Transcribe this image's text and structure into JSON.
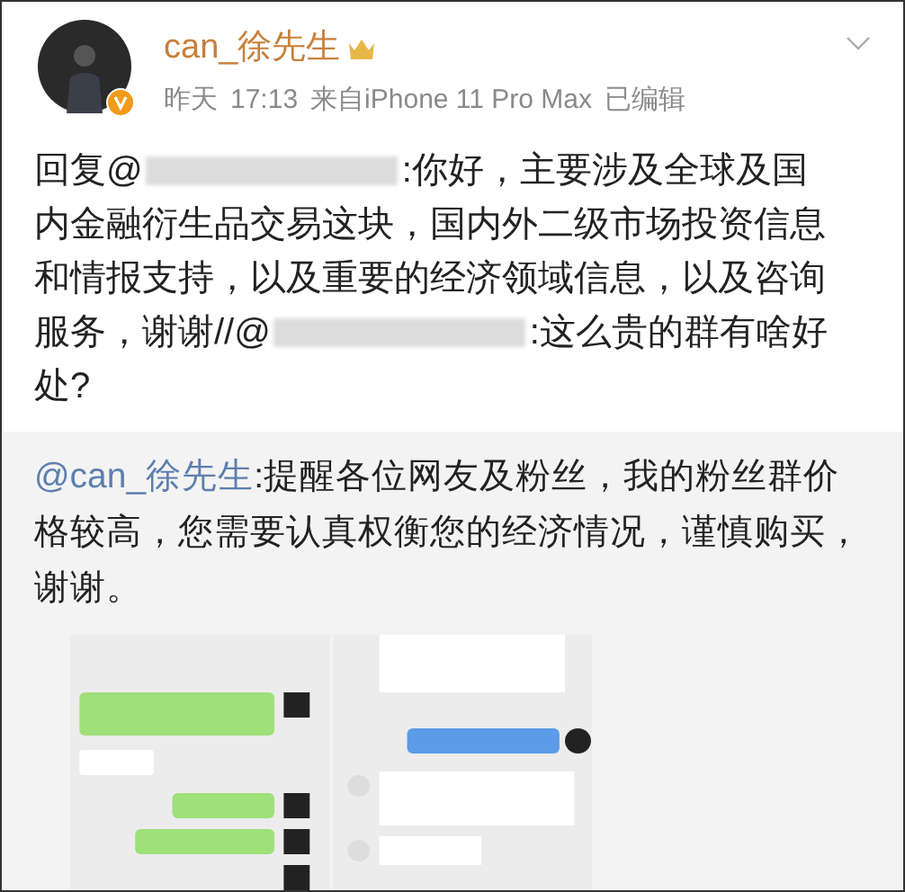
{
  "post": {
    "author": "can_徐先生",
    "meta": [
      "昨天",
      "17:13",
      "来自iPhone 11 Pro Max",
      "已编辑"
    ],
    "body": [
      [
        {
          "kind": "text",
          "text": "回复@"
        },
        {
          "kind": "redacted"
        },
        {
          "kind": "text",
          "text": ":你好，主要涉及全球及国"
        }
      ],
      [
        {
          "kind": "text",
          "text": "内金融衍生品交易这块，国内外二级市场投资信息"
        }
      ],
      [
        {
          "kind": "text",
          "text": "和情报支持，以及重要的经济领域信息，以及咨询"
        }
      ],
      [
        {
          "kind": "text",
          "text": "服务，谢谢//@"
        },
        {
          "kind": "redacted"
        },
        {
          "kind": "text",
          "text": ":这么贵的群有啥好"
        }
      ],
      [
        {
          "kind": "text",
          "text": "处?"
        }
      ]
    ]
  },
  "repost": {
    "mention": "@can_徐先生",
    "text": ":提醒各位网友及粉丝，我的粉丝群价格较高，您需要认真权衡您的经济情况，谨慎购买，谢谢。"
  }
}
